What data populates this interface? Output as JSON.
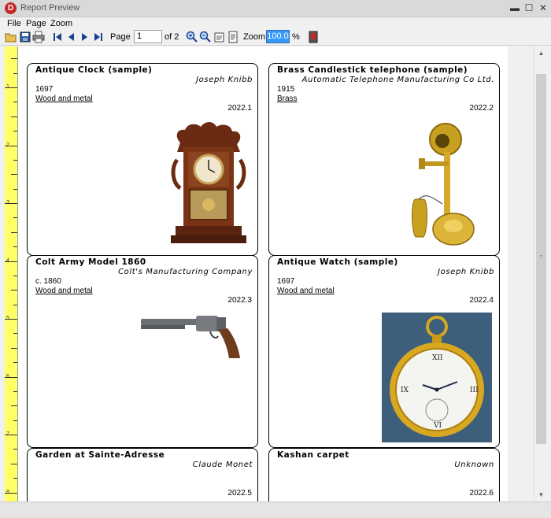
{
  "window": {
    "title": "Report Preview",
    "logo_letter": "D",
    "minimize": "▬",
    "maximize": "☐",
    "close": "✕"
  },
  "menu": {
    "file": "File",
    "page": "Page",
    "zoom": "Zoom"
  },
  "toolbar": {
    "page_label": "Page",
    "page_value": "1",
    "page_of": "of 2",
    "zoom_label": "Zoom",
    "zoom_value": "100.0",
    "zoom_unit": "%"
  },
  "ruler": {
    "labels": [
      "1",
      "2",
      "3",
      "4",
      "5",
      "6",
      "7",
      "8"
    ]
  },
  "cards": [
    {
      "title": "Antique Clock (sample)",
      "maker": "Joseph Knibb",
      "year": "1697",
      "material": "Wood and metal",
      "id": "2022.1",
      "image": "clock-image"
    },
    {
      "title": "Brass Candlestick telephone (sample)",
      "maker": "Automatic Telephone Manufacturing Co Ltd.",
      "year": "1915",
      "material": "Brass",
      "id": "2022.2",
      "image": "telephone-image"
    },
    {
      "title": "Colt Army Model 1860",
      "maker": "Colt's Manufacturing Company",
      "year": "c. 1860",
      "material": "Wood and metal",
      "id": "2022.3",
      "image": "revolver-image"
    },
    {
      "title": "Antique Watch (sample)",
      "maker": "Joseph Knibb",
      "year": "1697",
      "material": "Wood and metal",
      "id": "2022.4",
      "image": "pocket-watch-image"
    },
    {
      "title": "Garden at Sainte-Adresse",
      "maker": "Claude Monet",
      "year": "",
      "material": "",
      "id": "2022.5",
      "image": ""
    },
    {
      "title": "Kashan carpet",
      "maker": "Unknown",
      "year": "",
      "material": "",
      "id": "2022.6",
      "image": ""
    }
  ],
  "colors": {
    "ruler": "#ffff66",
    "zoom_highlight": "#3399ff",
    "logo": "#c62828"
  }
}
